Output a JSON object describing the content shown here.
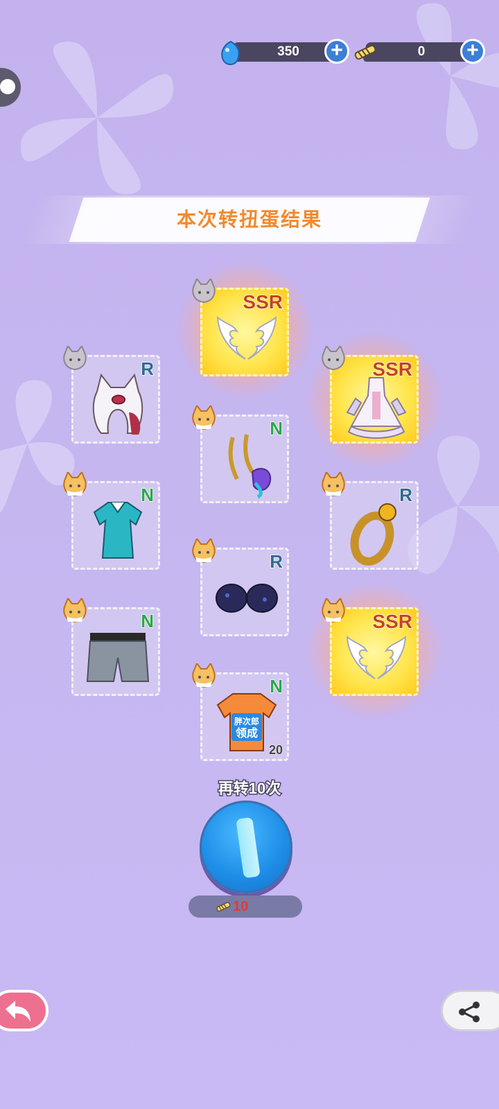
{
  "currency": {
    "gems": {
      "value": "350",
      "icon": "blue-gem-icon"
    },
    "tickets": {
      "value": "0",
      "icon": "fishbone-ticket-icon"
    }
  },
  "banner": {
    "title": "本次转扭蛋结果"
  },
  "items": [
    {
      "name": "angel-wings",
      "rarity": "SSR",
      "badge": "gray-cat-avatar"
    },
    {
      "name": "white-cat-hood",
      "rarity": "R",
      "badge": "gray-cat-avatar"
    },
    {
      "name": "white-lace-dress",
      "rarity": "SSR",
      "badge": "gray-cat-avatar"
    },
    {
      "name": "golden-antlers-and-fish-accessory",
      "rarity": "N",
      "badge": "orange-cat-avatar"
    },
    {
      "name": "teal-polo-dress",
      "rarity": "N",
      "badge": "orange-cat-avatar"
    },
    {
      "name": "gold-ring",
      "rarity": "R",
      "badge": "orange-cat-avatar"
    },
    {
      "name": "navy-gloves",
      "rarity": "R",
      "badge": "orange-cat-avatar"
    },
    {
      "name": "denim-shorts",
      "rarity": "N",
      "badge": "orange-cat-avatar"
    },
    {
      "name": "angel-wings-2",
      "rarity": "SSR",
      "badge": "orange-cat-avatar"
    },
    {
      "name": "orange-tshirt",
      "rarity": "N",
      "badge": "orange-cat-avatar",
      "count": "20",
      "shirt_text_1": "胖次郎",
      "shirt_text_2": "领成"
    }
  ],
  "spin": {
    "label": "再转10次",
    "cost": "10",
    "cost_icon": "fishbone-ticket-icon"
  },
  "buttons": {
    "back_icon": "back-arrow-icon",
    "share_icon": "share-icon"
  }
}
